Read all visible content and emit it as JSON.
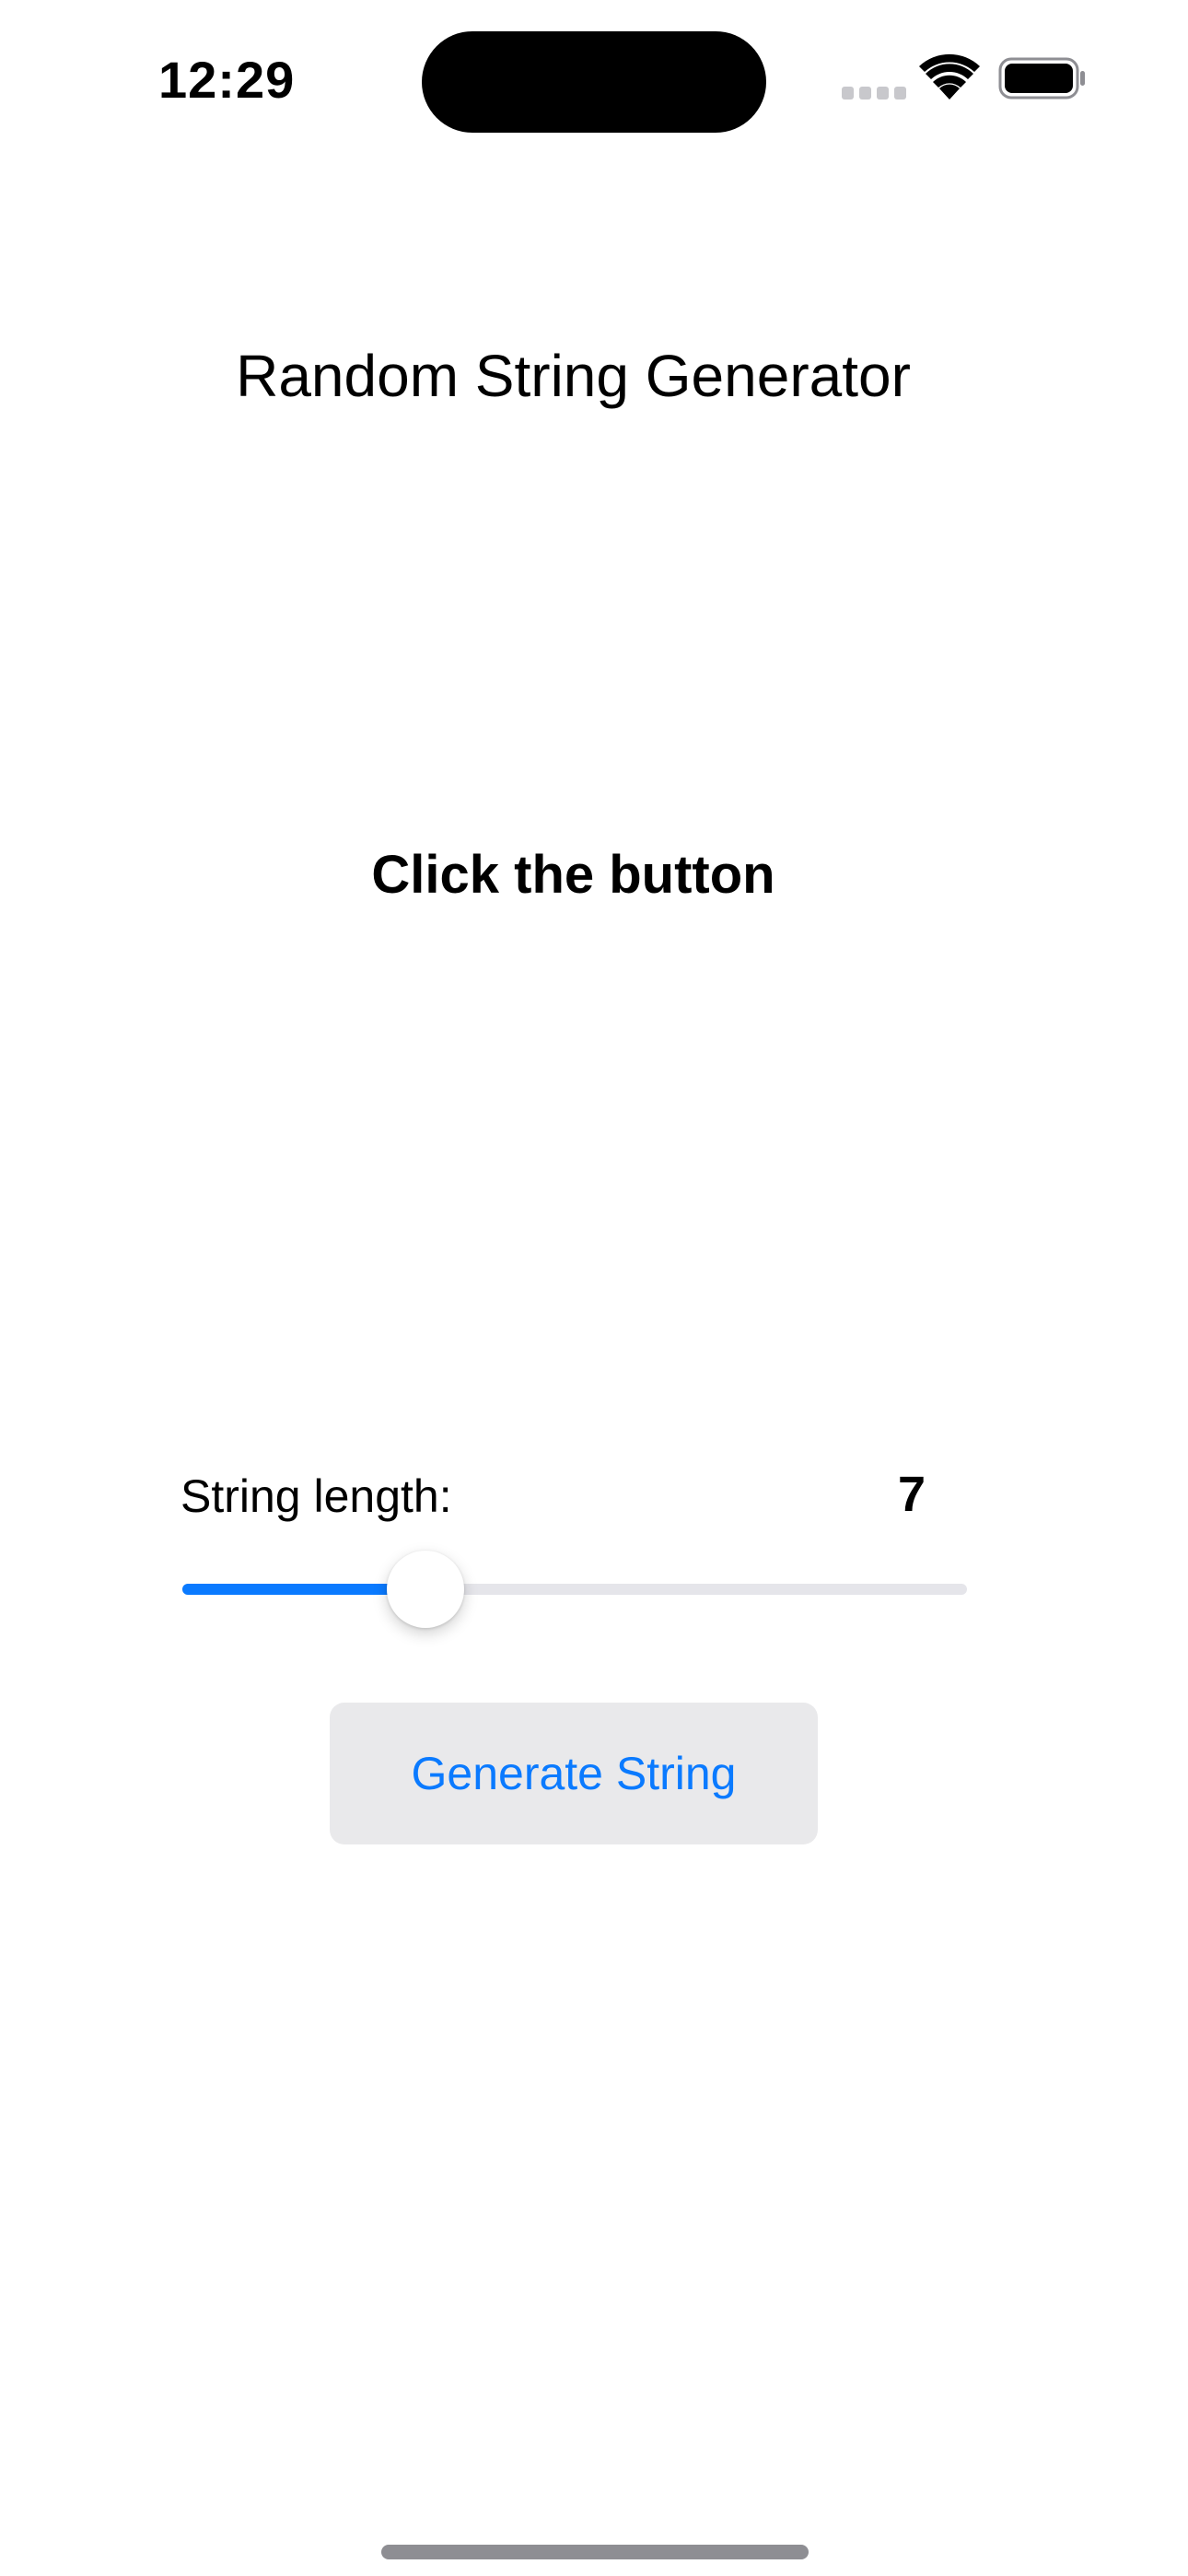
{
  "status_bar": {
    "time": "12:29",
    "icons": [
      "cellular-signal-icon",
      "wifi-icon",
      "battery-icon"
    ]
  },
  "app": {
    "title": "Random String Generator",
    "result": "Click the button"
  },
  "length_control": {
    "label": "String length:",
    "value": "7",
    "slider": {
      "value": 7,
      "fraction": 0.31
    }
  },
  "generate_button": {
    "label": "Generate String"
  },
  "colors": {
    "accent": "#0a7aff",
    "button_background": "#e9e9eb",
    "track": "#e5e5ea",
    "text": "#000000"
  }
}
